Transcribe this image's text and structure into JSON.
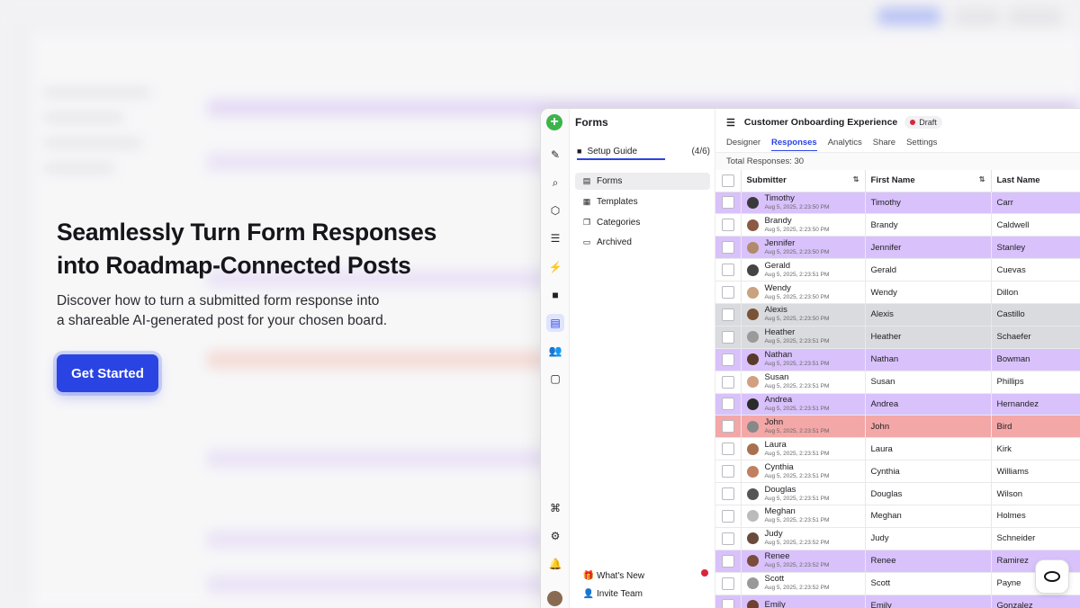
{
  "hero": {
    "title_line1": "Seamlessly Turn Form Responses",
    "title_line2": "into Roadmap-Connected Posts",
    "desc_line1": "Discover how to turn a submitted form response into",
    "desc_line2": "a shareable AI-generated post for your chosen board.",
    "cta_label": "Get Started"
  },
  "colors": {
    "accent": "#2a44e3",
    "row_purple": "#d9c2fb",
    "row_gray": "#dadbde",
    "row_red": "#f3a7a7",
    "logo_green": "#3cb44b"
  },
  "rail": {
    "icons": [
      "edit-icon",
      "search-icon",
      "cube-icon",
      "sliders-icon",
      "bolt-icon",
      "book-icon",
      "forms-icon",
      "team-icon",
      "chat-icon",
      "command-icon",
      "gear-icon",
      "bell-icon"
    ]
  },
  "sidebar": {
    "title": "Forms",
    "setup_guide": {
      "label": "Setup Guide",
      "count": "(4/6)"
    },
    "items": [
      {
        "label": "Forms",
        "icon": "table-icon"
      },
      {
        "label": "Templates",
        "icon": "template-icon"
      },
      {
        "label": "Categories",
        "icon": "copy-icon"
      },
      {
        "label": "Archived",
        "icon": "archive-icon"
      }
    ],
    "whats_new": "What's New",
    "invite_team": "Invite Team"
  },
  "main": {
    "title": "Customer Onboarding Experience",
    "status": "Draft",
    "tabs": [
      "Designer",
      "Responses",
      "Analytics",
      "Share",
      "Settings"
    ],
    "active_tab": "Responses",
    "total": "Total Responses: 30",
    "columns": [
      "Submitter",
      "First Name",
      "Last Name"
    ]
  },
  "rows": [
    {
      "name": "Timothy",
      "date": "Aug 5, 2025, 2:23:50 PM",
      "first": "Timothy",
      "last": "Carr",
      "color": "purple"
    },
    {
      "name": "Brandy",
      "date": "Aug 5, 2025, 2:23:50 PM",
      "first": "Brandy",
      "last": "Caldwell",
      "color": ""
    },
    {
      "name": "Jennifer",
      "date": "Aug 5, 2025, 2:23:50 PM",
      "first": "Jennifer",
      "last": "Stanley",
      "color": "purple"
    },
    {
      "name": "Gerald",
      "date": "Aug 5, 2025, 2:23:51 PM",
      "first": "Gerald",
      "last": "Cuevas",
      "color": ""
    },
    {
      "name": "Wendy",
      "date": "Aug 5, 2025, 2:23:50 PM",
      "first": "Wendy",
      "last": "Dillon",
      "color": ""
    },
    {
      "name": "Alexis",
      "date": "Aug 5, 2025, 2:23:50 PM",
      "first": "Alexis",
      "last": "Castillo",
      "color": "gray"
    },
    {
      "name": "Heather",
      "date": "Aug 5, 2025, 2:23:51 PM",
      "first": "Heather",
      "last": "Schaefer",
      "color": "gray"
    },
    {
      "name": "Nathan",
      "date": "Aug 5, 2025, 2:23:51 PM",
      "first": "Nathan",
      "last": "Bowman",
      "color": "purple"
    },
    {
      "name": "Susan",
      "date": "Aug 5, 2025, 2:23:51 PM",
      "first": "Susan",
      "last": "Phillips",
      "color": ""
    },
    {
      "name": "Andrea",
      "date": "Aug 5, 2025, 2:23:51 PM",
      "first": "Andrea",
      "last": "Hernandez",
      "color": "purple"
    },
    {
      "name": "John",
      "date": "Aug 5, 2025, 2:23:51 PM",
      "first": "John",
      "last": "Bird",
      "color": "red"
    },
    {
      "name": "Laura",
      "date": "Aug 5, 2025, 2:23:51 PM",
      "first": "Laura",
      "last": "Kirk",
      "color": ""
    },
    {
      "name": "Cynthia",
      "date": "Aug 5, 2025, 2:23:51 PM",
      "first": "Cynthia",
      "last": "Williams",
      "color": ""
    },
    {
      "name": "Douglas",
      "date": "Aug 5, 2025, 2:23:51 PM",
      "first": "Douglas",
      "last": "Wilson",
      "color": ""
    },
    {
      "name": "Meghan",
      "date": "Aug 5, 2025, 2:23:51 PM",
      "first": "Meghan",
      "last": "Holmes",
      "color": ""
    },
    {
      "name": "Judy",
      "date": "Aug 5, 2025, 2:23:52 PM",
      "first": "Judy",
      "last": "Schneider",
      "color": ""
    },
    {
      "name": "Renee",
      "date": "Aug 5, 2025, 2:23:52 PM",
      "first": "Renee",
      "last": "Ramirez",
      "color": "purple"
    },
    {
      "name": "Scott",
      "date": "Aug 5, 2025, 2:23:52 PM",
      "first": "Scott",
      "last": "Payne",
      "color": ""
    },
    {
      "name": "Emily",
      "date": "",
      "first": "Emily",
      "last": "Gonzalez",
      "color": "purple"
    }
  ]
}
